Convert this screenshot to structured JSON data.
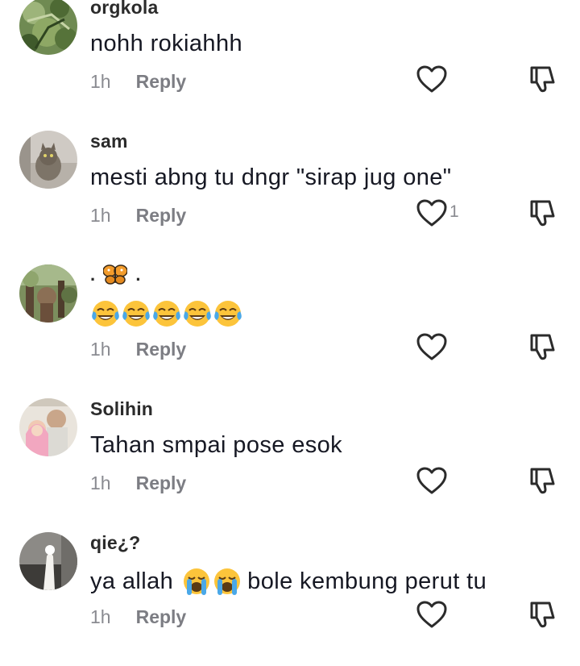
{
  "comments": [
    {
      "username": "orgkola",
      "text": "nohh rokiahhh",
      "time": "1h",
      "reply_label": "Reply",
      "like_count": "",
      "avatar": "avatar-photo-plants"
    },
    {
      "username": "sam",
      "text": "mesti abng tu dngr \"sirap jug one\"",
      "time": "1h",
      "reply_label": "Reply",
      "like_count": "1",
      "avatar": "avatar-photo-cat"
    },
    {
      "username": ". 🦋 .",
      "username_parts": [
        ".",
        "butterfly-emoji",
        "."
      ],
      "text": "😂😂😂😂😂",
      "text_emoji": [
        "face-with-tears-of-joy",
        "face-with-tears-of-joy",
        "face-with-tears-of-joy",
        "face-with-tears-of-joy",
        "face-with-tears-of-joy"
      ],
      "time": "1h",
      "reply_label": "Reply",
      "like_count": "",
      "avatar": "avatar-photo-outdoor"
    },
    {
      "username": "Solihin",
      "text": "Tahan smpai pose esok",
      "time": "1h",
      "reply_label": "Reply",
      "like_count": "",
      "avatar": "avatar-photo-family"
    },
    {
      "username": "qie¿?",
      "text_before": "ya allah",
      "text_emoji": [
        "loudly-crying-face",
        "loudly-crying-face"
      ],
      "text_after": "bole kembung perut tu",
      "time": "1h",
      "reply_label": "Reply",
      "like_count": "",
      "avatar": "avatar-photo-hand"
    }
  ],
  "icons": {
    "like": "heart-outline-icon",
    "dislike": "thumbs-down-icon"
  },
  "colors": {
    "text": "#161823",
    "username": "#2b2b2b",
    "muted": "#8a8b91",
    "icon": "#2b2b2b"
  }
}
